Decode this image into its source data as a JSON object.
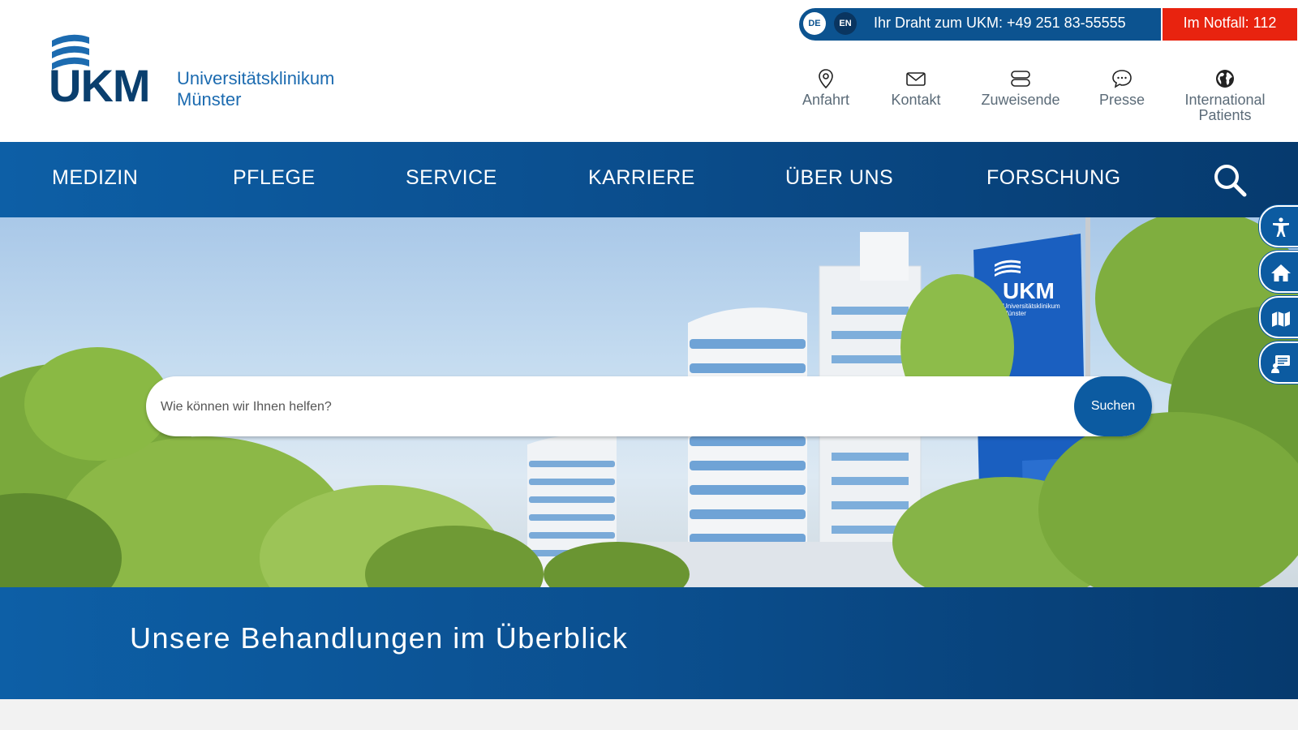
{
  "logo": {
    "abbr": "UKM",
    "name_line1": "Universitätsklinikum",
    "name_line2": "Münster"
  },
  "topbar": {
    "lang_de": "DE",
    "lang_en": "EN",
    "hotline": "Ihr Draht zum UKM: +49 251 83-55555",
    "emergency": "Im Notfall: 112"
  },
  "quicklinks": [
    {
      "label": "Anfahrt",
      "icon": "location-pin-icon"
    },
    {
      "label": "Kontakt",
      "icon": "envelope-icon"
    },
    {
      "label": "Zuweisende",
      "icon": "referral-icon"
    },
    {
      "label": "Presse",
      "icon": "speech-bubble-icon"
    },
    {
      "label": "International",
      "label2": "Patients",
      "icon": "globe-icon"
    }
  ],
  "nav": {
    "items": [
      "MEDIZIN",
      "PFLEGE",
      "SERVICE",
      "KARRIERE",
      "ÜBER UNS",
      "FORSCHUNG"
    ]
  },
  "hero": {
    "flag_abbr": "UKM",
    "flag_name1": "Universitätsklinikum",
    "flag_name2": "Münster",
    "search_placeholder": "Wie können wir Ihnen helfen?",
    "search_button": "Suchen"
  },
  "sidetools": [
    "accessibility-icon",
    "home-icon",
    "map-icon",
    "chat-icon"
  ],
  "band": {
    "title": "Unsere Behandlungen im Überblick"
  },
  "colors": {
    "primary": "#0c5ba1",
    "dark": "#063a6e",
    "emergency": "#e8230f",
    "logo_dark": "#0a3f6e",
    "logo_light": "#1c6bb0"
  }
}
